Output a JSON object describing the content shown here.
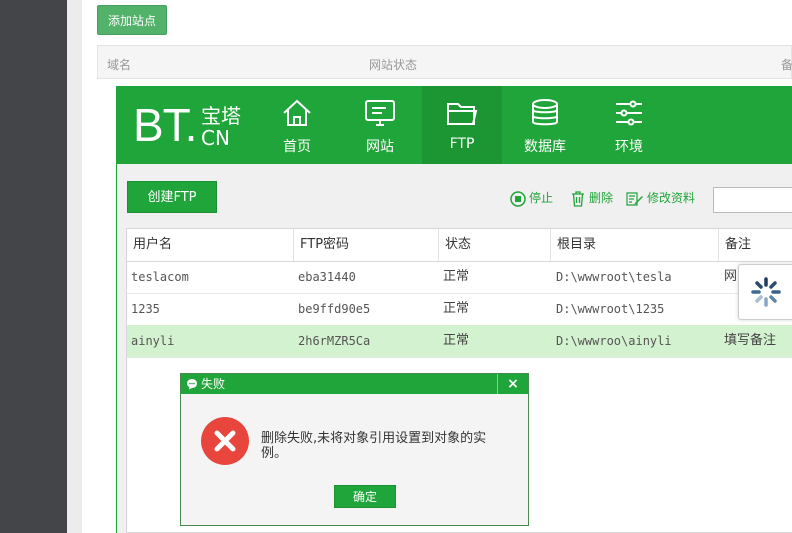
{
  "background": {
    "add_site_label": "添加站点",
    "table_headers": [
      "域名",
      "网站状态",
      "备"
    ]
  },
  "brand": {
    "logo_bt": "BT.",
    "logo_cn_top": "宝塔",
    "logo_cn_bottom": "CN"
  },
  "nav": [
    {
      "label": "首页",
      "icon": "home-icon"
    },
    {
      "label": "网站",
      "icon": "monitor-icon"
    },
    {
      "label": "FTP",
      "icon": "folder-icon",
      "active": true
    },
    {
      "label": "数据库",
      "icon": "database-icon"
    },
    {
      "label": "环境",
      "icon": "sliders-icon"
    }
  ],
  "toolbar": {
    "create_label": "创建FTP",
    "stop_label": "停止",
    "delete_label": "删除",
    "edit_label": "修改资料",
    "search_value": ""
  },
  "table": {
    "headers": [
      "用户名",
      "FTP密码",
      "状态",
      "根目录",
      "备注"
    ],
    "rows": [
      {
        "user": "teslacom",
        "password": "eba31440",
        "status": "正常",
        "root": "D:\\wwwroot\\tesla",
        "note": "网"
      },
      {
        "user": "1235",
        "password": "be9ffd90e5",
        "status": "正常",
        "root": "D:\\wwwroot\\1235",
        "note": ""
      },
      {
        "user": "ainyli",
        "password": "2h6rMZR5Ca",
        "status": "正常",
        "root": "D:\\wwwroo\\ainyli",
        "note": "填写备注",
        "selected": true
      }
    ]
  },
  "dialog": {
    "title": "失败",
    "message": "删除失败,未将对象引用设置到对象的实例。",
    "ok_label": "确定",
    "close_glyph": "×"
  },
  "colors": {
    "brand_green": "#20a53a",
    "selected_row": "#d3f2cf",
    "error_red": "#e8463c"
  }
}
